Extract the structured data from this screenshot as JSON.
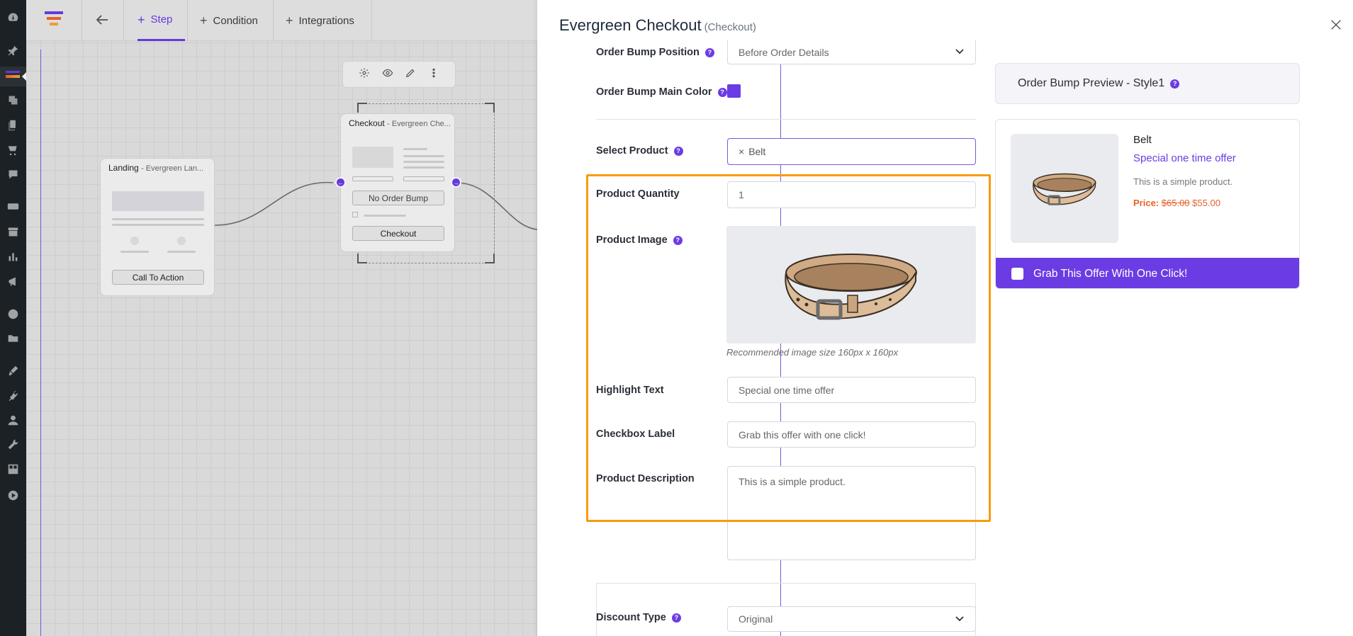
{
  "topbar": {
    "tabs": [
      {
        "label": "Step",
        "active": true
      },
      {
        "label": "Condition",
        "active": false
      },
      {
        "label": "Integrations",
        "active": false
      }
    ]
  },
  "canvas": {
    "landing_node": {
      "title": "Landing",
      "subtitle": "- Evergreen Lan...",
      "button": "Call To Action"
    },
    "checkout_node": {
      "title": "Checkout",
      "subtitle": "- Evergreen Che...",
      "order_bump_button": "No Order Bump",
      "checkout_button": "Checkout"
    }
  },
  "drawer": {
    "title": "Evergreen Checkout",
    "subtitle": "(Checkout)",
    "fields": {
      "order_bump_position": {
        "label": "Order Bump Position",
        "value": "Before Order Details"
      },
      "order_bump_main_color": {
        "label": "Order Bump Main Color",
        "value": "#6b3ce4"
      },
      "select_product": {
        "label": "Select Product",
        "value": "Belt"
      },
      "product_quantity": {
        "label": "Product Quantity",
        "value": "1"
      },
      "product_image": {
        "label": "Product Image",
        "note": "Recommended image size 160px x 160px"
      },
      "highlight_text": {
        "label": "Highlight Text",
        "value": "Special one time offer"
      },
      "checkbox_label": {
        "label": "Checkbox Label",
        "value": "Grab this offer with one click!"
      },
      "product_description": {
        "label": "Product Description",
        "value": "This is a simple product."
      },
      "discount_type": {
        "label": "Discount Type",
        "value": "Original"
      }
    },
    "preview": {
      "header": "Order Bump Preview - Style1",
      "product_name": "Belt",
      "highlight": "Special one time offer",
      "description": "This is a simple product.",
      "price_label": "Price:",
      "old_price": "$65.00",
      "new_price": "$55.00",
      "offer_label": "Grab This Offer With One Click!"
    }
  },
  "colors": {
    "accent": "#6b3ce4",
    "highlight_border": "#f79c0f",
    "price": "#e7622a"
  }
}
